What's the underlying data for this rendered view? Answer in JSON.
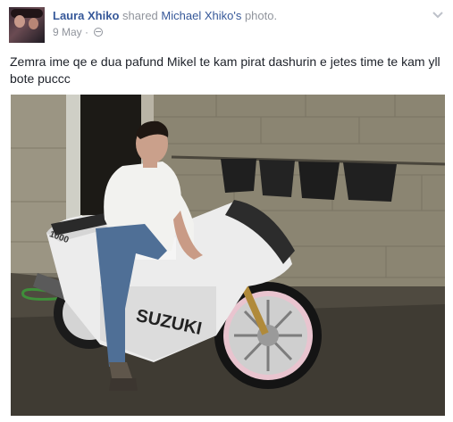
{
  "post": {
    "author": "Laura Xhiko",
    "action_text": " shared ",
    "shared_from": "Michael Xhiko's",
    "object_text": " photo.",
    "date": "9 May",
    "separator": " · ",
    "privacy_icon": "globe-icon",
    "options_icon": "chevron-down-icon",
    "body_text": "Zemra ime qe e dua pafund Mikel te kam pirat dashurin e jetes time te kam yll bote puccc"
  },
  "photo": {
    "brand_text": "SUZUKI",
    "fairing_number": "1000",
    "subject": "man-on-motorcycle-image"
  },
  "colors": {
    "link": "#365899",
    "meta": "#90949c",
    "text": "#1d2129"
  }
}
